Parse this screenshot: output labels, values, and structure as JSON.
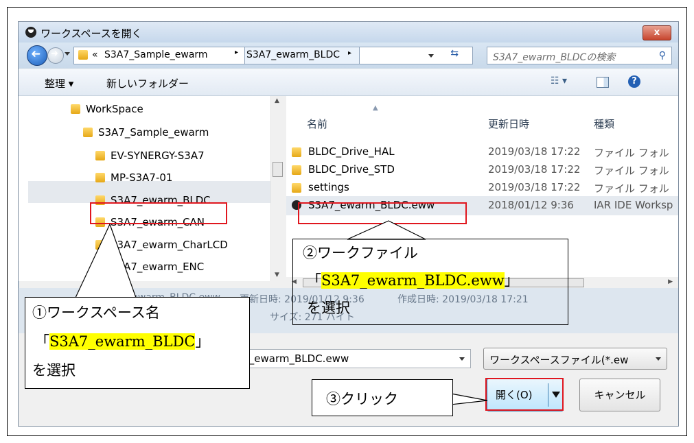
{
  "dialog": {
    "title": "ワークスペースを開く",
    "close_label": "x"
  },
  "address": {
    "prefix": "«",
    "crumb1": "S3A7_Sample_ewarm",
    "crumb2": "S3A7_ewarm_BLDC",
    "search_placeholder": "S3A7_ewarm_BLDCの検索"
  },
  "toolbar": {
    "organize_label": "整理 ▾",
    "new_folder_label": "新しいフォルダー",
    "view_icon": "☷ ▾",
    "help_label": "?"
  },
  "tree": {
    "items": [
      {
        "label": "WorkSpace"
      },
      {
        "label": "S3A7_Sample_ewarm"
      },
      {
        "label": "EV-SYNERGY-S3A7"
      },
      {
        "label": "MP-S3A7-01"
      },
      {
        "label": "S3A7_ewarm_BLDC"
      },
      {
        "label": "S3A7_ewarm_CAN"
      },
      {
        "label": "S3A7_ewarm_CharLCD"
      },
      {
        "label": "S3A7_ewarm_ENC"
      }
    ]
  },
  "files": {
    "headers": {
      "name": "名前",
      "date": "更新日時",
      "type": "種類"
    },
    "rows": [
      {
        "name": "BLDC_Drive_HAL",
        "date": "2019/03/18 17:22",
        "type": "ファイル フォル"
      },
      {
        "name": "BLDC_Drive_STD",
        "date": "2019/03/18 17:22",
        "type": "ファイル フォル"
      },
      {
        "name": "settings",
        "date": "2019/03/18 17:22",
        "type": "ファイル フォル"
      },
      {
        "name": "S3A7_ewarm_BLDC.eww",
        "date": "2018/01/12 9:36",
        "type": "IAR IDE Worksp"
      }
    ]
  },
  "details": {
    "filename_partial": "S3A7_ewarm_BLDC.eww",
    "modified_label": "更新日時: 2019/01/12 9:36",
    "created_label": "作成日時: 2019/03/18 17:21",
    "size_label": "サイズ: 271 バイト"
  },
  "bottom": {
    "filename_value": "A7_ewarm_BLDC.eww",
    "filetype_value": "ワークスペースファイル(*.ew",
    "open_label": "開く(O)",
    "cancel_label": "キャンセル"
  },
  "callouts": {
    "c1_line1": "①ワークスペース名",
    "c1_open": "「",
    "c1_name": "S3A7_ewarm_BLDC",
    "c1_close": "」",
    "c1_line3": "を選択",
    "c2_line1": "②ワークファイル",
    "c2_open": "「",
    "c2_name": "S3A7_ewarm_BLDC.eww",
    "c2_close": "」",
    "c2_line3": "を選択",
    "c3_label": "③クリック"
  }
}
